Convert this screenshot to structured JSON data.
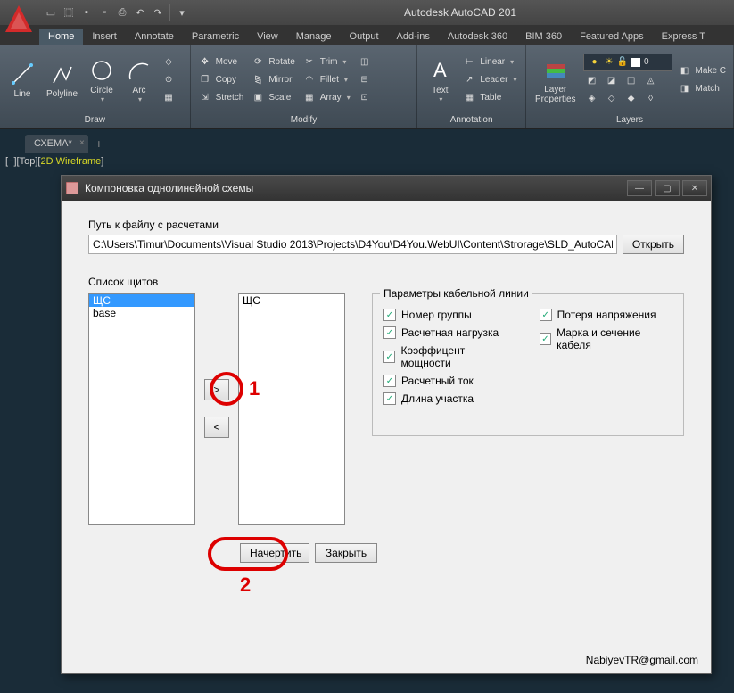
{
  "app": {
    "title": "Autodesk AutoCAD 201"
  },
  "qat": [
    "new",
    "open",
    "save",
    "saveas",
    "plot",
    "undo",
    "redo"
  ],
  "tabs": [
    "Home",
    "Insert",
    "Annotate",
    "Parametric",
    "View",
    "Manage",
    "Output",
    "Add-ins",
    "Autodesk 360",
    "BIM 360",
    "Featured Apps",
    "Express T"
  ],
  "active_tab": 0,
  "panels": {
    "draw": {
      "label": "Draw",
      "line": "Line",
      "polyline": "Polyline",
      "circle": "Circle",
      "arc": "Arc"
    },
    "modify": {
      "label": "Modify",
      "move": "Move",
      "copy": "Copy",
      "stretch": "Stretch",
      "rotate": "Rotate",
      "mirror": "Mirror",
      "scale": "Scale",
      "trim": "Trim",
      "fillet": "Fillet",
      "array": "Array"
    },
    "annotation": {
      "label": "Annotation",
      "text": "Text",
      "linear": "Linear",
      "leader": "Leader",
      "table": "Table"
    },
    "layers": {
      "label": "Layers",
      "props": "Layer\nProperties",
      "make": "Make C",
      "match": "Match",
      "layer0": "0"
    }
  },
  "doc_tab": "СХЕМА*",
  "viewport": {
    "a": "[−][Top]",
    "b": "[",
    "c": "2D Wireframe",
    "d": "]"
  },
  "dialog": {
    "title": "Компоновка однолинейной схемы",
    "path_label": "Путь к файлу с расчетами",
    "path_value": "C:\\Users\\Timur\\Documents\\Visual Studio 2013\\Projects\\D4You\\D4You.WebUI\\Content\\Strorage\\SLD_AutoCAD",
    "open_btn": "Открыть",
    "list_label": "Список щитов",
    "left_list": [
      "ЩС",
      "base"
    ],
    "left_selected": 0,
    "right_list": [
      "ЩС"
    ],
    "move_right": ">",
    "move_left": "<",
    "groupbox_title": "Параметры кабельной линии",
    "checks_left": [
      "Номер группы",
      "Расчетная нагрузка",
      "Коэффицент мощности",
      "Расчетный ток",
      "Длина участка"
    ],
    "checks_right": [
      "Потеря напряжения",
      "Марка и сечение кабеля"
    ],
    "draw_btn": "Начертить",
    "close_btn": "Закрыть",
    "footer": "NabiyevTR@gmail.com"
  },
  "annotations": {
    "num1": "1",
    "num2": "2"
  }
}
